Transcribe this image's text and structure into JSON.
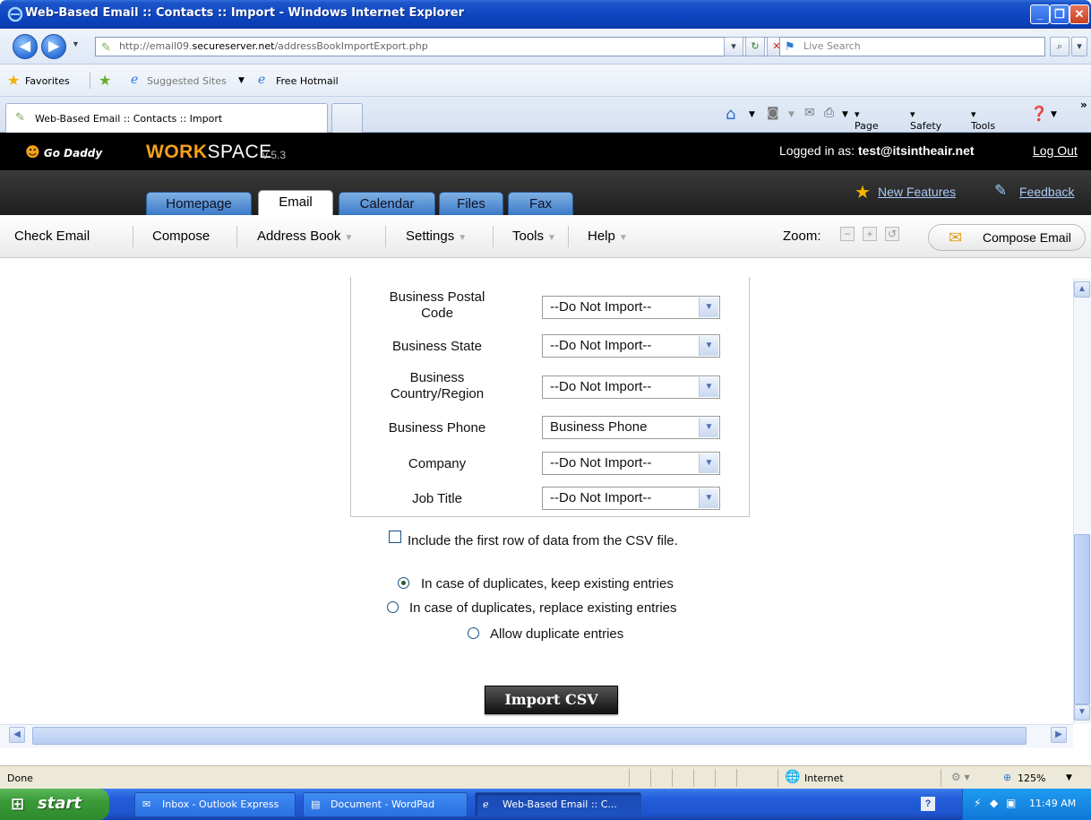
{
  "window": {
    "title": "Web-Based Email :: Contacts :: Import - Windows Internet Explorer"
  },
  "browser": {
    "address": "http://email09.secureserver.net/addressBookImportExport.php",
    "address_prefix": "http://email09.",
    "address_domain": "secureserver.net",
    "address_suffix": "/addressBookImportExport.php",
    "search_placeholder": "Live Search",
    "favorites_label": "Favorites",
    "suggested_sites": "Suggested Sites",
    "free_hotmail": "Free Hotmail",
    "tab_title": "Web-Based Email :: Contacts :: Import",
    "cmd_page": "Page",
    "cmd_safety": "Safety",
    "cmd_tools": "Tools"
  },
  "workspace": {
    "logo_text": "Go Daddy",
    "title_bold": "WORK",
    "title_rest": "SPACE",
    "version": "v 5.3",
    "logged_in_label": "Logged in as:",
    "logged_in_user": "test@itsintheair.net",
    "logout": "Log Out",
    "new_features": "New Features",
    "feedback": "Feedback"
  },
  "app_tabs": [
    {
      "label": "Homepage",
      "active": false
    },
    {
      "label": "Email",
      "active": true
    },
    {
      "label": "Calendar",
      "active": false
    },
    {
      "label": "Files",
      "active": false
    },
    {
      "label": "Fax",
      "active": false
    }
  ],
  "menu": {
    "check_email": "Check Email",
    "compose": "Compose",
    "address_book": "Address Book",
    "settings": "Settings",
    "tools": "Tools",
    "help": "Help",
    "zoom_label": "Zoom:",
    "compose_email": "Compose Email"
  },
  "mapping_rows": [
    {
      "field": "Business Postal Code",
      "line1": "Business Postal",
      "line2": "Code",
      "value": "--Do Not Import--"
    },
    {
      "field": "Business State",
      "line1": "Business State",
      "line2": "",
      "value": "--Do Not Import--"
    },
    {
      "field": "Business Country/Region",
      "line1": "Business",
      "line2": "Country/Region",
      "value": "--Do Not Import--"
    },
    {
      "field": "Business Phone",
      "line1": "Business Phone",
      "line2": "",
      "value": "Business Phone"
    },
    {
      "field": "Company",
      "line1": "Company",
      "line2": "",
      "value": "--Do Not Import--"
    },
    {
      "field": "Job Title",
      "line1": "Job Title",
      "line2": "",
      "value": "--Do Not Import--"
    }
  ],
  "options": {
    "include_first_row": "Include the first row of data from the CSV file.",
    "include_first_row_checked": false,
    "dup_keep": "In case of duplicates, keep existing entries",
    "dup_replace": "In case of duplicates, replace existing entries",
    "dup_allow": "Allow duplicate entries",
    "selected": "dup_keep"
  },
  "import_button": "Import CSV",
  "status": {
    "text": "Done",
    "zone": "Internet",
    "zoom": "125%"
  },
  "taskbar": {
    "start": "start",
    "items": [
      {
        "label": "Inbox - Outlook Express",
        "active": false
      },
      {
        "label": "Document - WordPad",
        "active": false
      },
      {
        "label": "Web-Based Email :: C...",
        "active": true
      }
    ],
    "clock": "11:49 AM"
  }
}
